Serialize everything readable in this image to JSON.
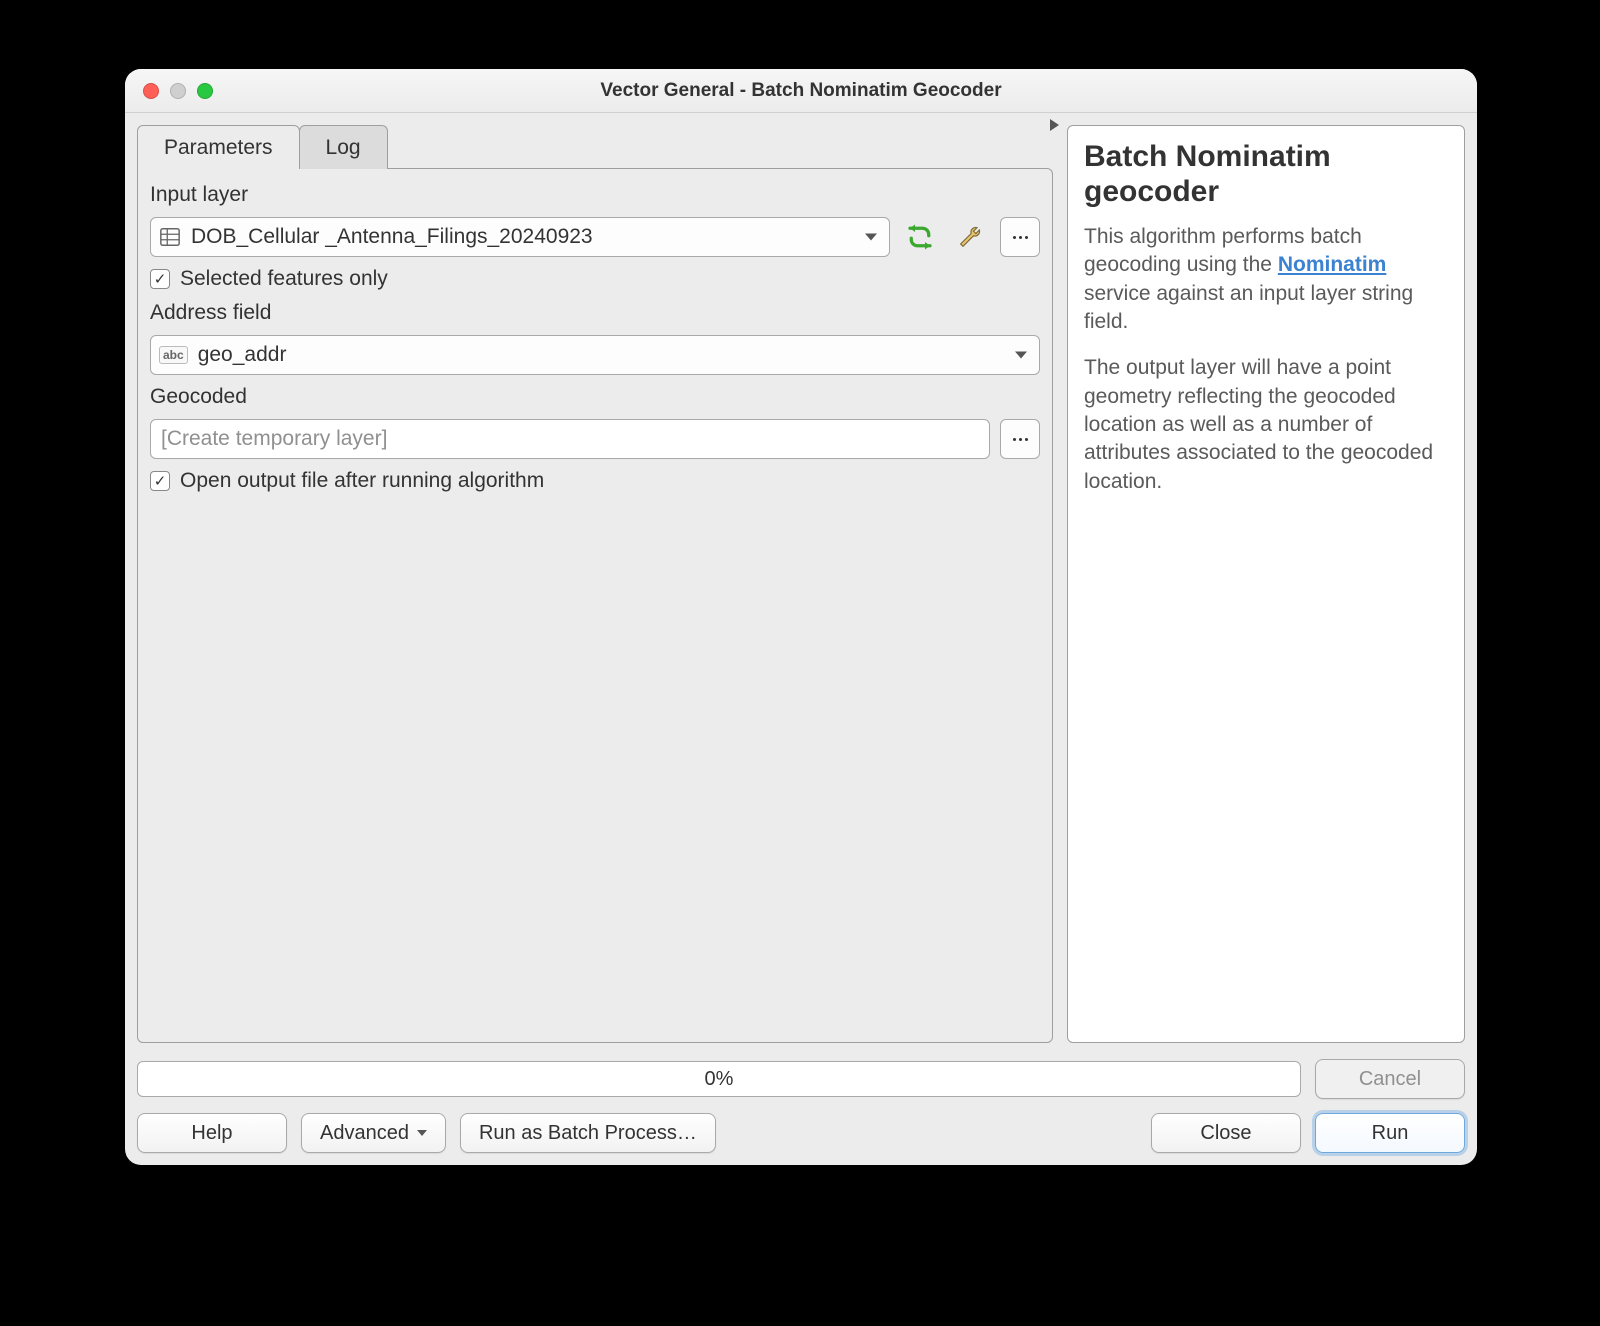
{
  "window": {
    "title": "Vector General - Batch Nominatim Geocoder"
  },
  "tabs": {
    "parameters": "Parameters",
    "log": "Log",
    "active": "parameters"
  },
  "params": {
    "input_layer_label": "Input layer",
    "input_layer_value": "DOB_Cellular _Antenna_Filings_20240923",
    "selected_only_checked": true,
    "selected_only_label": "Selected features only",
    "address_field_label": "Address field",
    "address_field_value": "geo_addr",
    "geocoded_label": "Geocoded",
    "geocoded_placeholder": "[Create temporary layer]",
    "open_output_checked": true,
    "open_output_label": "Open output file after running algorithm"
  },
  "side": {
    "title": "Batch Nominatim geocoder",
    "p1a": "This algorithm performs batch geocoding using the ",
    "link": "Nominatim",
    "p1b": " service against an input layer string field.",
    "p2": "The output layer will have a point geometry reflecting the geocoded location as well as a number of attributes associated to the geocoded location."
  },
  "progress": {
    "text": "0%",
    "cancel": "Cancel"
  },
  "buttons": {
    "help": "Help",
    "advanced": "Advanced",
    "batch": "Run as Batch Process…",
    "close": "Close",
    "run": "Run"
  }
}
